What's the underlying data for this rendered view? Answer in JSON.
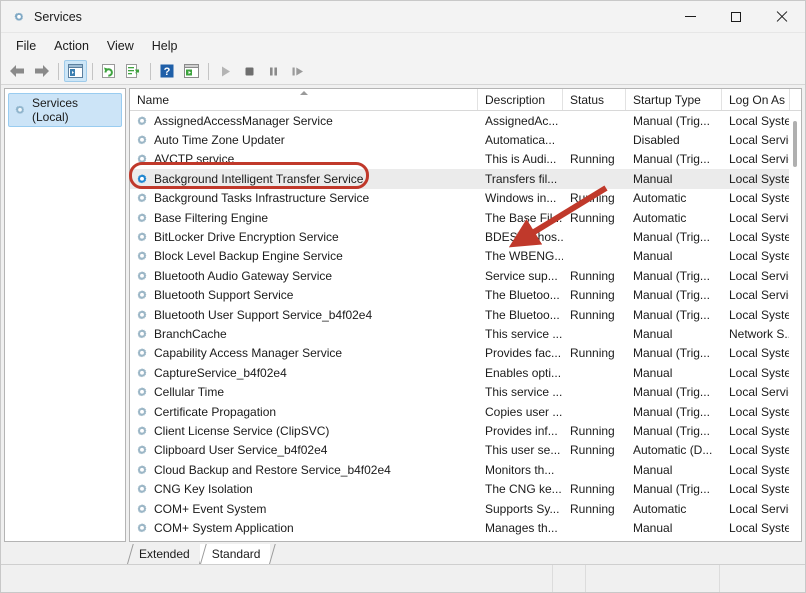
{
  "window": {
    "title": "Services",
    "icon": "services-gear-icon",
    "controls": {
      "minimize": "minimize-icon",
      "maximize": "maximize-icon",
      "close": "close-icon"
    }
  },
  "menubar": {
    "items": [
      "File",
      "Action",
      "View",
      "Help"
    ]
  },
  "toolbar": {
    "buttons": [
      {
        "name": "back-button",
        "icon": "arrow-left-icon"
      },
      {
        "name": "forward-button",
        "icon": "arrow-right-icon"
      },
      {
        "name": "show-hide-console-tree-button",
        "icon": "console-tree-icon",
        "selected": true
      },
      {
        "name": "refresh-button",
        "icon": "refresh-icon"
      },
      {
        "name": "export-list-button",
        "icon": "export-list-icon"
      },
      {
        "name": "help-button",
        "icon": "help-question-icon"
      },
      {
        "name": "properties-button",
        "icon": "properties-window-icon"
      },
      {
        "name": "start-service-button",
        "icon": "play-icon"
      },
      {
        "name": "stop-service-button",
        "icon": "stop-icon"
      },
      {
        "name": "pause-service-button",
        "icon": "pause-icon"
      },
      {
        "name": "restart-service-button",
        "icon": "restart-icon"
      }
    ]
  },
  "tree": {
    "root_label": "Services (Local)",
    "root_icon": "services-gear-icon"
  },
  "list": {
    "columns": [
      "Name",
      "Description",
      "Status",
      "Startup Type",
      "Log On As"
    ],
    "sort_column": "Name",
    "sort_direction": "ascending",
    "rows": [
      {
        "name": "AssignedAccessManager Service",
        "description": "AssignedAc...",
        "status": "",
        "startup": "Manual (Trig...",
        "logon": "Local Syste..",
        "selected": false
      },
      {
        "name": "Auto Time Zone Updater",
        "description": "Automatica...",
        "status": "",
        "startup": "Disabled",
        "logon": "Local Servic",
        "selected": false
      },
      {
        "name": "AVCTP service",
        "description": "This is Audi...",
        "status": "Running",
        "startup": "Manual (Trig...",
        "logon": "Local Servic",
        "selected": false
      },
      {
        "name": "Background Intelligent Transfer Service",
        "description": "Transfers fil...",
        "status": "",
        "startup": "Manual",
        "logon": "Local Syste..",
        "selected": true
      },
      {
        "name": "Background Tasks Infrastructure Service",
        "description": "Windows in...",
        "status": "Running",
        "startup": "Automatic",
        "logon": "Local Syste..",
        "selected": false
      },
      {
        "name": "Base Filtering Engine",
        "description": "The Base Fil...",
        "status": "Running",
        "startup": "Automatic",
        "logon": "Local Servic",
        "selected": false
      },
      {
        "name": "BitLocker Drive Encryption Service",
        "description": "BDESVC hos...",
        "status": "",
        "startup": "Manual (Trig...",
        "logon": "Local Syste..",
        "selected": false
      },
      {
        "name": "Block Level Backup Engine Service",
        "description": "The WBENG...",
        "status": "",
        "startup": "Manual",
        "logon": "Local Syste..",
        "selected": false
      },
      {
        "name": "Bluetooth Audio Gateway Service",
        "description": "Service sup...",
        "status": "Running",
        "startup": "Manual (Trig...",
        "logon": "Local Servic",
        "selected": false
      },
      {
        "name": "Bluetooth Support Service",
        "description": "The Bluetoo...",
        "status": "Running",
        "startup": "Manual (Trig...",
        "logon": "Local Servic",
        "selected": false
      },
      {
        "name": "Bluetooth User Support Service_b4f02e4",
        "description": "The Bluetoo...",
        "status": "Running",
        "startup": "Manual (Trig...",
        "logon": "Local Syste..",
        "selected": false
      },
      {
        "name": "BranchCache",
        "description": "This service ...",
        "status": "",
        "startup": "Manual",
        "logon": "Network S...",
        "selected": false
      },
      {
        "name": "Capability Access Manager Service",
        "description": "Provides fac...",
        "status": "Running",
        "startup": "Manual (Trig...",
        "logon": "Local Syste..",
        "selected": false
      },
      {
        "name": "CaptureService_b4f02e4",
        "description": "Enables opti...",
        "status": "",
        "startup": "Manual",
        "logon": "Local Syste..",
        "selected": false
      },
      {
        "name": "Cellular Time",
        "description": "This service ...",
        "status": "",
        "startup": "Manual (Trig...",
        "logon": "Local Servic",
        "selected": false
      },
      {
        "name": "Certificate Propagation",
        "description": "Copies user ...",
        "status": "",
        "startup": "Manual (Trig...",
        "logon": "Local Syste..",
        "selected": false
      },
      {
        "name": "Client License Service (ClipSVC)",
        "description": "Provides inf...",
        "status": "Running",
        "startup": "Manual (Trig...",
        "logon": "Local Syste..",
        "selected": false
      },
      {
        "name": "Clipboard User Service_b4f02e4",
        "description": "This user se...",
        "status": "Running",
        "startup": "Automatic (D...",
        "logon": "Local Syste..",
        "selected": false
      },
      {
        "name": "Cloud Backup and Restore Service_b4f02e4",
        "description": "Monitors th...",
        "status": "",
        "startup": "Manual",
        "logon": "Local Syste..",
        "selected": false
      },
      {
        "name": "CNG Key Isolation",
        "description": "The CNG ke...",
        "status": "Running",
        "startup": "Manual (Trig...",
        "logon": "Local Syste..",
        "selected": false
      },
      {
        "name": "COM+ Event System",
        "description": "Supports Sy...",
        "status": "Running",
        "startup": "Automatic",
        "logon": "Local Servic",
        "selected": false
      },
      {
        "name": "COM+ System Application",
        "description": "Manages th...",
        "status": "",
        "startup": "Manual",
        "logon": "Local Syste..",
        "selected": false
      }
    ]
  },
  "tabs": [
    {
      "label": "Extended",
      "active": false
    },
    {
      "label": "Standard",
      "active": true
    }
  ],
  "annotations": {
    "highlight_target": "Background Intelligent Transfer Service",
    "highlight_color": "#c0392b",
    "arrow_color": "#c0392b"
  },
  "colors": {
    "selection": "#ebebeb",
    "tree_selection": "#cce4f7",
    "window_bg": "#f3f3f3",
    "accent_red": "#c0392b"
  }
}
